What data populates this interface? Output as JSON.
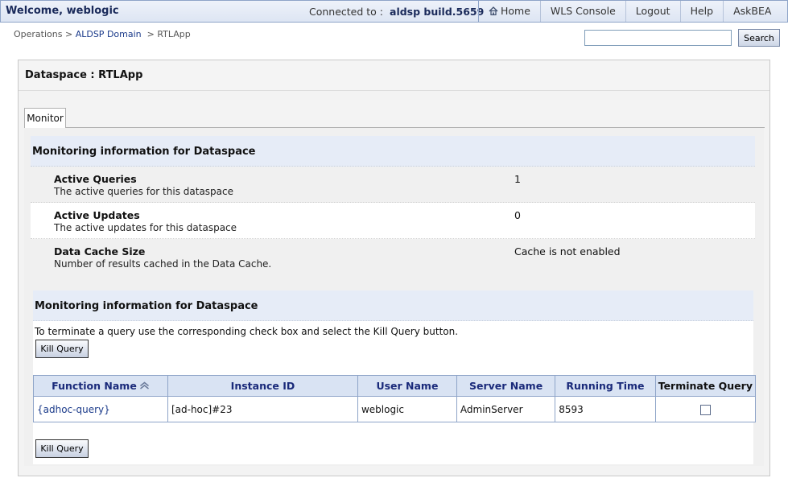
{
  "header": {
    "welcome": "Welcome, weblogic",
    "connected_label": "Connected to :",
    "connected_value": "aldsp  build.5659",
    "nav": [
      "Home",
      "WLS Console",
      "Logout",
      "Help",
      "AskBEA"
    ]
  },
  "breadcrumb": {
    "items": [
      "Operations",
      "ALDSP Domain",
      "RTLApp"
    ],
    "separator": ">"
  },
  "search": {
    "value": "",
    "button_label": "Search"
  },
  "panel": {
    "title": "Dataspace : RTLApp",
    "tab": "Monitor"
  },
  "monitor": {
    "section_title": "Monitoring information for Dataspace",
    "properties": [
      {
        "name": "Active Queries",
        "description": "The active queries for this dataspace",
        "value": "1"
      },
      {
        "name": "Active Updates",
        "description": "The active updates for this dataspace",
        "value": "0"
      },
      {
        "name": "Data Cache Size",
        "description": "Number of results cached in the Data Cache.",
        "value": "Cache is not enabled"
      }
    ]
  },
  "queries": {
    "section_title": "Monitoring information for Dataspace",
    "instructions": "To terminate a query use the corresponding check box and select the Kill Query button.",
    "kill_button_label": "Kill Query",
    "columns": [
      "Function Name",
      "Instance ID",
      "User Name",
      "Server Name",
      "Running Time",
      "Terminate Query"
    ],
    "rows": [
      {
        "function_name": "{adhoc-query}",
        "instance_id": "[ad-hoc]#23",
        "user_name": "weblogic",
        "server_name": "AdminServer",
        "running_time": "8593",
        "terminate": false
      }
    ]
  },
  "colors": {
    "header_border": "#8ea4c8",
    "section_bg": "#e6ecf7",
    "table_header_bg": "#d9e3f3",
    "link": "#1a3a8a"
  }
}
